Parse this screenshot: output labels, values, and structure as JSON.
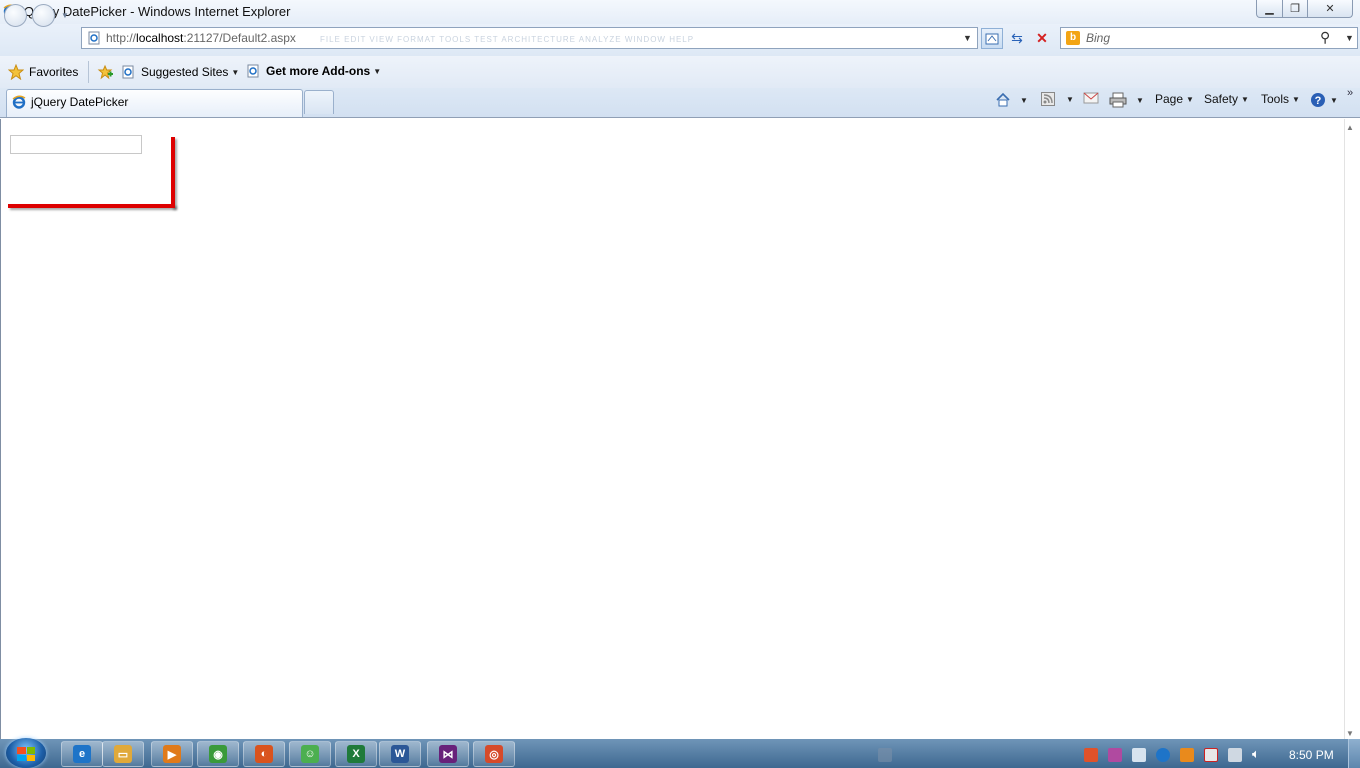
{
  "window": {
    "title": "jQuery DatePicker - Windows Internet Explorer"
  },
  "address_bar": {
    "url_prefix": "http://",
    "url_host": "localhost",
    "url_rest": ":21127/Default2.aspx",
    "ghost_menu": "FILE    EDIT    VIEW    FORMAT    TOOLS    TEST    ARCHITECTURE    ANALYZE    WINDOW    HELP"
  },
  "search": {
    "placeholder": "Bing",
    "logo": "b"
  },
  "favorites_bar": {
    "favorites_label": "Favorites",
    "suggested_sites_label": "Suggested Sites",
    "addons_label": "Get more Add-ons"
  },
  "tabs": [
    {
      "title": "jQuery DatePicker",
      "active": true
    }
  ],
  "command_bar": {
    "page_label": "Page",
    "safety_label": "Safety",
    "tools_label": "Tools"
  },
  "page": {
    "date_input_value": ""
  },
  "taskbar": {
    "clock": "8:50 PM",
    "apps": [
      {
        "name": "internet-explorer",
        "color": "#1e74c8",
        "glyph": "e"
      },
      {
        "name": "windows-explorer",
        "color": "#e0a93a",
        "glyph": "▭"
      },
      {
        "name": "media-player",
        "color": "#e07a1a",
        "glyph": "▶"
      },
      {
        "name": "chrome",
        "color": "#3a9a3a",
        "glyph": "◉"
      },
      {
        "name": "firefox",
        "color": "#d9531e",
        "glyph": "◐"
      },
      {
        "name": "messenger",
        "color": "#4caf50",
        "glyph": "☺"
      },
      {
        "name": "excel",
        "color": "#1f7a3a",
        "glyph": "X"
      },
      {
        "name": "word",
        "color": "#2b5797",
        "glyph": "W"
      },
      {
        "name": "visual-studio",
        "color": "#68217a",
        "glyph": "⋈"
      },
      {
        "name": "snipping-tool",
        "color": "#d64a2a",
        "glyph": "◎"
      }
    ]
  },
  "colors": {
    "annotation_red": "#dd0000",
    "chrome_blue": "#dde8f5"
  }
}
